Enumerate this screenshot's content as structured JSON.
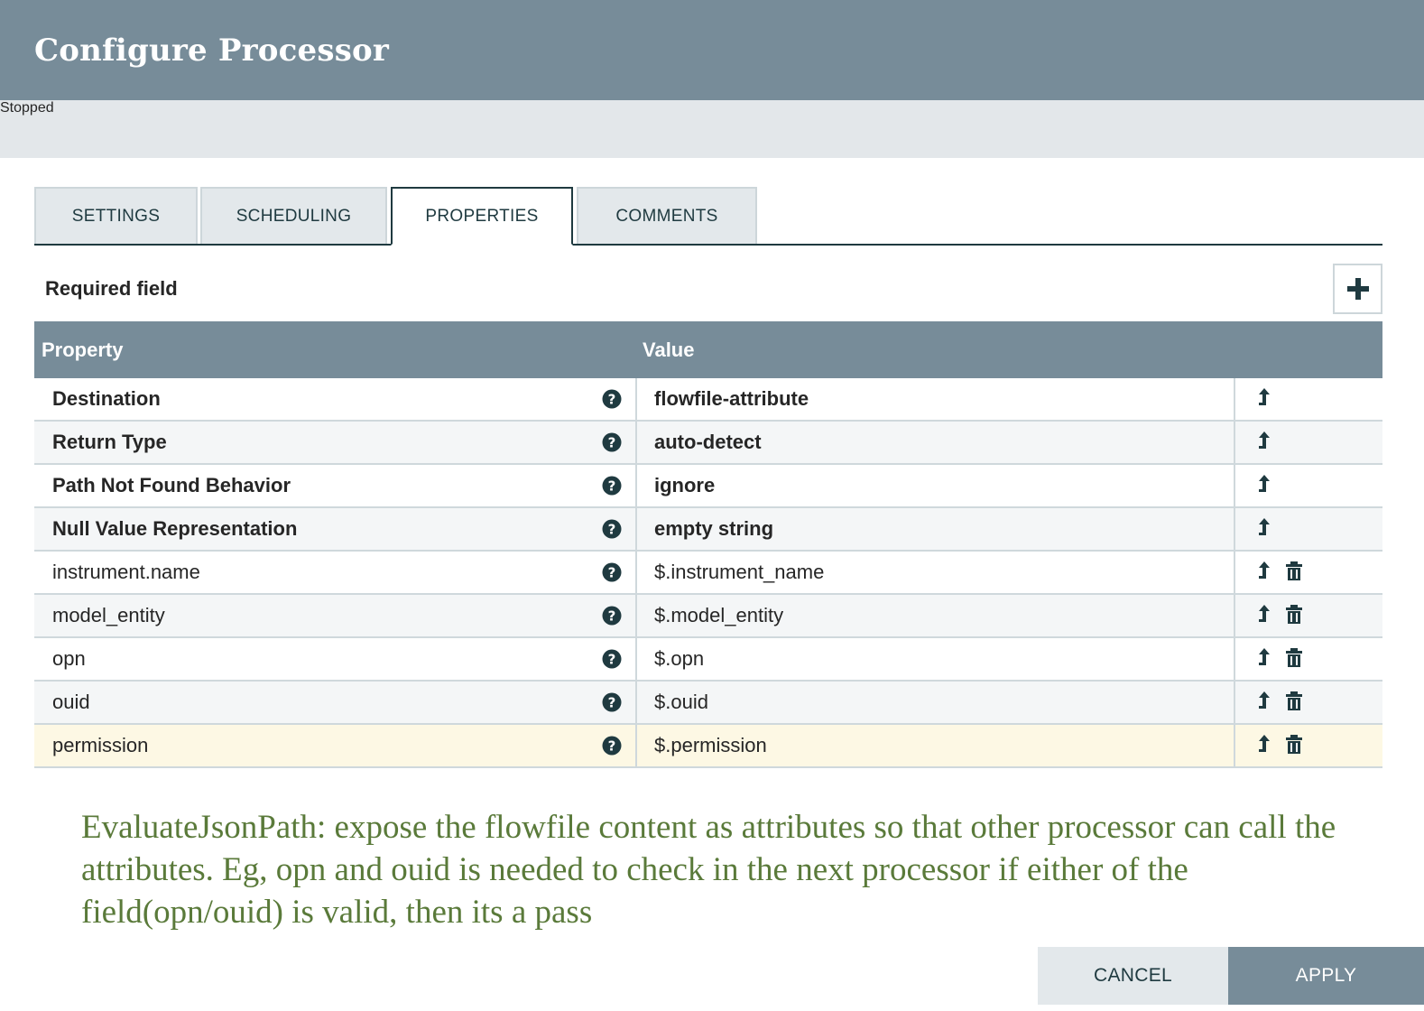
{
  "dialog": {
    "title": "Configure Processor"
  },
  "status": {
    "label": "Stopped",
    "color": "#d38e8e"
  },
  "tabs": [
    {
      "label": "SETTINGS",
      "active": false
    },
    {
      "label": "SCHEDULING",
      "active": false
    },
    {
      "label": "PROPERTIES",
      "active": true
    },
    {
      "label": "COMMENTS",
      "active": false
    }
  ],
  "properties": {
    "required_label": "Required field",
    "add_icon": "plus-icon",
    "columns": [
      "Property",
      "Value"
    ],
    "rows": [
      {
        "name": "Destination",
        "value": "flowfile-attribute",
        "required": true,
        "deletable": false
      },
      {
        "name": "Return Type",
        "value": "auto-detect",
        "required": true,
        "deletable": false
      },
      {
        "name": "Path Not Found Behavior",
        "value": "ignore",
        "required": true,
        "deletable": false
      },
      {
        "name": "Null Value Representation",
        "value": "empty string",
        "required": true,
        "deletable": false
      },
      {
        "name": "instrument.name",
        "value": "$.instrument_name",
        "required": false,
        "deletable": true
      },
      {
        "name": "model_entity",
        "value": "$.model_entity",
        "required": false,
        "deletable": true
      },
      {
        "name": "opn",
        "value": "$.opn",
        "required": false,
        "deletable": true
      },
      {
        "name": "ouid",
        "value": "$.ouid",
        "required": false,
        "deletable": true
      },
      {
        "name": "permission",
        "value": "$.permission",
        "required": false,
        "deletable": true,
        "selected": true
      }
    ]
  },
  "annotation": {
    "text": "EvaluateJsonPath: expose the flowfile content as attributes so that other processor can call the attributes. Eg, opn and ouid is needed to check in the next processor if either of the field(opn/ouid) is valid, then its a pass",
    "color": "#5a7a3a"
  },
  "footer": {
    "cancel_label": "CANCEL",
    "apply_label": "APPLY"
  },
  "colors": {
    "header": "#778c99",
    "accent": "#1f3a40"
  }
}
